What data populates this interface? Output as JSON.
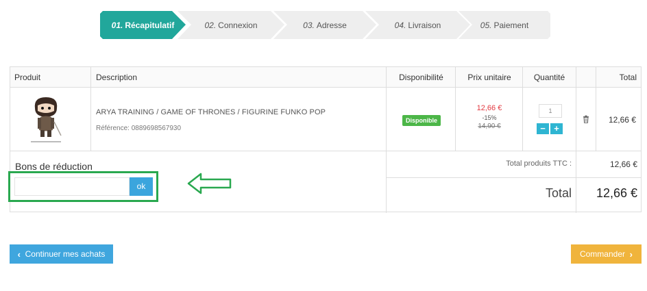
{
  "steps": [
    {
      "num": "01.",
      "label": "Récapitulatif",
      "active": true
    },
    {
      "num": "02.",
      "label": "Connexion",
      "active": false
    },
    {
      "num": "03.",
      "label": "Adresse",
      "active": false
    },
    {
      "num": "04.",
      "label": "Livraison",
      "active": false
    },
    {
      "num": "05.",
      "label": "Paiement",
      "active": false
    }
  ],
  "colors": {
    "step_active": "#21a79b",
    "step_inactive": "#eeeeee",
    "voucher_highlight": "#29a84f",
    "in_stock": "#4cb648",
    "price_red": "#e2383f"
  },
  "table": {
    "headers": {
      "product": "Produit",
      "description": "Description",
      "availability": "Disponibilité",
      "unit_price": "Prix unitaire",
      "quantity": "Quantité",
      "total": "Total"
    }
  },
  "item": {
    "name": "ARYA TRAINING / GAME OF THRONES / FIGURINE FUNKO POP",
    "reference_label": "Référence:",
    "reference": "0889698567930",
    "availability": "Disponible",
    "price": "12,66 €",
    "discount": "-15%",
    "old_price": "14,90 €",
    "quantity": "1",
    "total": "12,66 €",
    "delete_icon": "trash-icon"
  },
  "voucher": {
    "title": "Bons de réduction",
    "button": "ok",
    "value": ""
  },
  "summary": {
    "products_label": "Total produits TTC :",
    "products_value": "12,66 €",
    "total_label": "Total",
    "total_value": "12,66 €"
  },
  "actions": {
    "continue": "Continuer mes achats",
    "order": "Commander"
  }
}
